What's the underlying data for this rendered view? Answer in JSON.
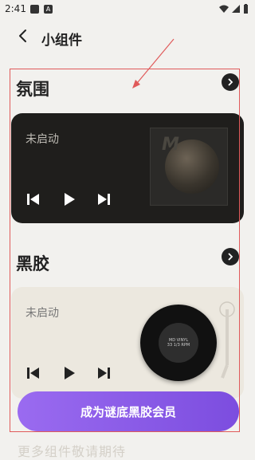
{
  "status_bar": {
    "time": "2:41"
  },
  "header": {
    "title": "小组件"
  },
  "section1": {
    "title": "氛围",
    "card": {
      "status": "未启动",
      "thumb_mark": "M"
    }
  },
  "section2": {
    "title": "黑胶",
    "card": {
      "status": "未启动",
      "record_line1": "MD VINYL",
      "record_line2": "33 1/3 RPM"
    }
  },
  "cta": {
    "label": "成为谜底黑胶会员"
  },
  "bottom_text": "更多组件敬请期待",
  "colors": {
    "accent_start": "#9a6bf0",
    "accent_end": "#7c4ddf",
    "annotation": "#e05a5a"
  }
}
